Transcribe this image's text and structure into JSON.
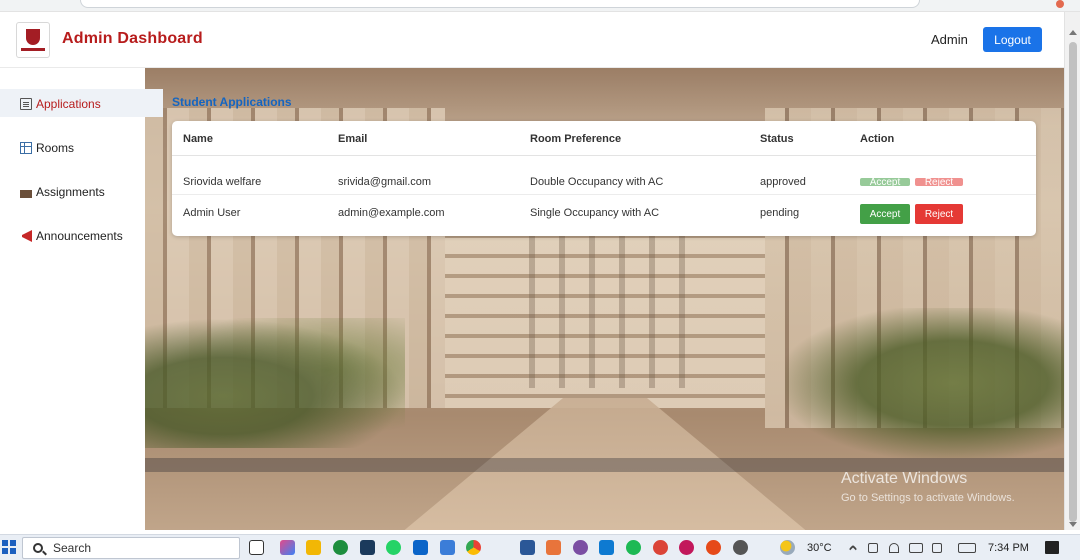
{
  "header": {
    "title": "Admin Dashboard",
    "user_label": "Admin",
    "logout_label": "Logout"
  },
  "sidebar": {
    "items": [
      {
        "label": "Applications",
        "icon": "document-icon",
        "active": true
      },
      {
        "label": "Rooms",
        "icon": "grid-icon",
        "active": false
      },
      {
        "label": "Assignments",
        "icon": "folder-icon",
        "active": false
      },
      {
        "label": "Announcements",
        "icon": "megaphone-icon",
        "active": false
      }
    ]
  },
  "main": {
    "section_title": "Student Applications",
    "table": {
      "columns": [
        "Name",
        "Email",
        "Room Preference",
        "Status",
        "Action"
      ],
      "rows": [
        {
          "name": "Sriovida welfare",
          "email": "srivida@gmail.com",
          "room": "Double Occupancy with AC",
          "status": "approved",
          "accept_label": "Accept",
          "reject_label": "Reject"
        },
        {
          "name": "Admin User",
          "email": "admin@example.com",
          "room": "Single Occupancy with AC",
          "status": "pending",
          "accept_label": "Accept",
          "reject_label": "Reject"
        }
      ]
    }
  },
  "watermark": {
    "line1": "Activate Windows",
    "line2": "Go to Settings to activate Windows."
  },
  "taskbar": {
    "search_placeholder": "Search",
    "temperature": "30°C",
    "time": "7:34 PM"
  },
  "colors": {
    "brand": "#b71c1c",
    "accent": "#1a73e8",
    "accept": "#43a047",
    "reject": "#e53935"
  }
}
